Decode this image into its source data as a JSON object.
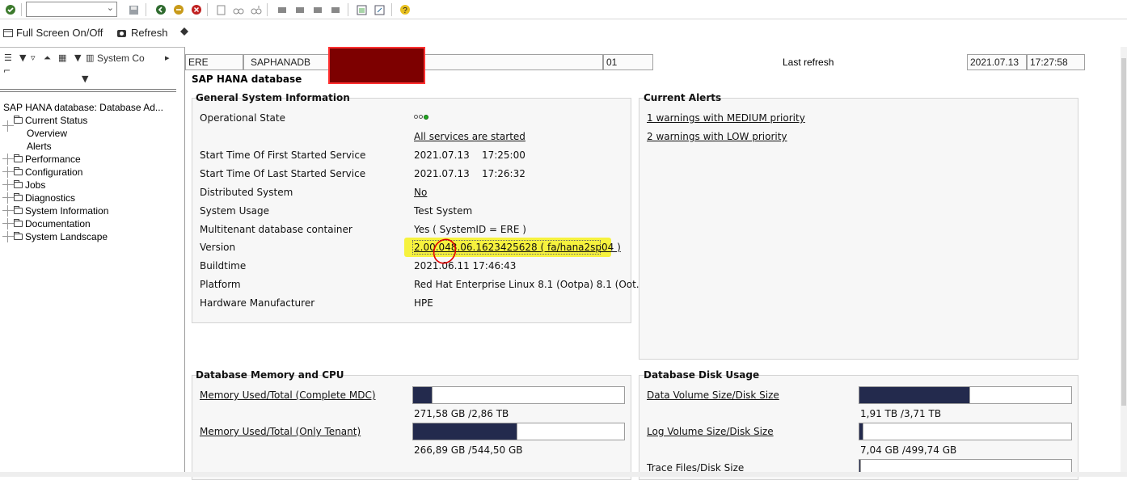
{
  "toolbar": {
    "command_field_value": "",
    "icons": [
      "checkmark-icon",
      "save-icon",
      "back-icon",
      "exit-icon",
      "cancel-icon",
      "print-icon",
      "find-icon",
      "find-next-icon",
      "first-page-icon",
      "previous-page-icon",
      "next-page-icon",
      "last-page-icon",
      "create-session-icon",
      "shortcut-icon",
      "help-icon"
    ]
  },
  "app_toolbar": {
    "fullscreen_label": "Full Screen On/Off",
    "refresh_label": "Refresh"
  },
  "tree_toolbar": {
    "system_config_label": "System Co"
  },
  "tree": {
    "root": "SAP HANA database: Database Ad...",
    "items": [
      {
        "label": "Current Status",
        "expanded": true
      },
      {
        "label": "Overview",
        "child": true
      },
      {
        "label": "Alerts",
        "child": true
      },
      {
        "label": "Performance"
      },
      {
        "label": "Configuration"
      },
      {
        "label": "Jobs"
      },
      {
        "label": "Diagnostics"
      },
      {
        "label": "System Information"
      },
      {
        "label": "Documentation"
      },
      {
        "label": "System Landscape"
      }
    ]
  },
  "header": {
    "sid": "ERE",
    "db_name": "SAPHANADB",
    "instance": "01",
    "last_refresh_label": "Last refresh",
    "last_refresh_date": "2021.07.13",
    "last_refresh_time": "17:27:58"
  },
  "page_title": "SAP HANA database",
  "general_info": {
    "title": "General System Information",
    "operational_state_label": "Operational State",
    "services_text": "All services are started",
    "rows": [
      {
        "label": "Start Time Of First Started Service",
        "value": "2021.07.13    17:25:00"
      },
      {
        "label": "Start Time Of Last Started Service",
        "value": "2021.07.13    17:26:32"
      },
      {
        "label": "Distributed System",
        "value": "No"
      },
      {
        "label": "System Usage",
        "value": "Test System"
      },
      {
        "label": "Multitenant database container",
        "value": "Yes ( SystemID = ERE )"
      },
      {
        "label": "Version",
        "value": "2.00.048.06.1623425628 ( fa/hana2sp04 )"
      },
      {
        "label": "Buildtime",
        "value": "2021.06.11 17:46:43"
      },
      {
        "label": "Platform",
        "value": "Red Hat Enterprise Linux 8.1 (Ootpa) 8.1 (Oot.."
      },
      {
        "label": "Hardware Manufacturer",
        "value": "HPE"
      }
    ]
  },
  "alerts": {
    "title": "Current Alerts",
    "medium": "1 warnings with MEDIUM priority",
    "low": "2 warnings with LOW priority"
  },
  "memory_cpu": {
    "title": "Database Memory and CPU",
    "rows": [
      {
        "label": "Memory Used/Total (Complete MDC)",
        "value": "271,58 GB /2,86 TB",
        "fraction": 0.09
      },
      {
        "label": "Memory Used/Total (Only Tenant)",
        "value": "266,89 GB /544,50 GB",
        "fraction": 0.49
      }
    ]
  },
  "disk_usage": {
    "title": "Database Disk Usage",
    "rows": [
      {
        "label": "Data Volume Size/Disk Size",
        "value": "1,91 TB /3,71 TB",
        "fraction": 0.52
      },
      {
        "label": "Log Volume Size/Disk Size",
        "value": "7,04 GB /499,74 GB",
        "fraction": 0.014
      },
      {
        "label": "Trace Files/Disk Size",
        "value": "",
        "fraction": 0.005
      }
    ]
  },
  "colors": {
    "bar_fill": "#232a4d",
    "highlight": "#f6f000",
    "redaction": "#7d0000",
    "annotation": "#e00000"
  }
}
